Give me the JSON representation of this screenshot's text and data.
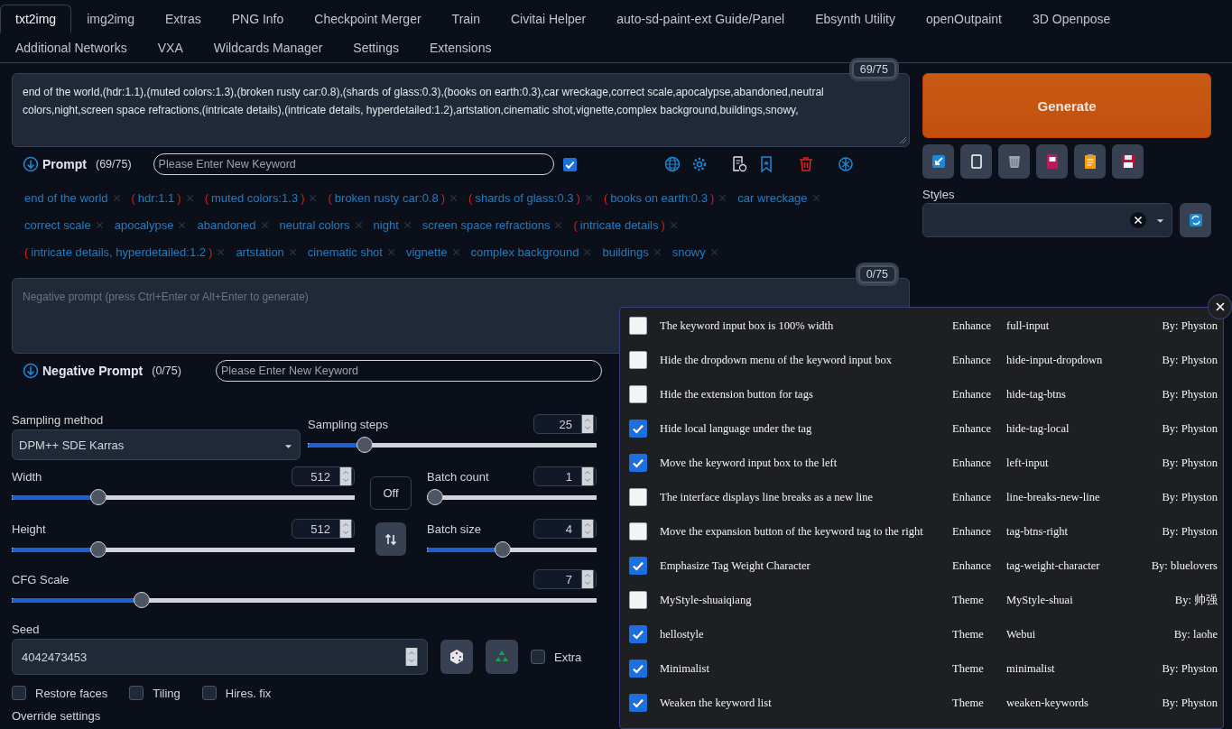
{
  "tab_rows": [
    [
      {
        "label": "txt2img",
        "selected": true
      },
      {
        "label": "img2img",
        "selected": false
      },
      {
        "label": "Extras",
        "selected": false
      },
      {
        "label": "PNG Info",
        "selected": false
      },
      {
        "label": "Checkpoint Merger",
        "selected": false
      },
      {
        "label": "Train",
        "selected": false
      },
      {
        "label": "Civitai Helper",
        "selected": false
      },
      {
        "label": "auto-sd-paint-ext Guide/Panel",
        "selected": false
      },
      {
        "label": "Ebsynth Utility",
        "selected": false
      },
      {
        "label": "openOutpaint",
        "selected": false
      },
      {
        "label": "3D Openpose",
        "selected": false
      }
    ],
    [
      {
        "label": "Additional Networks",
        "selected": false
      },
      {
        "label": "VXA",
        "selected": false
      },
      {
        "label": "Wildcards Manager",
        "selected": false
      },
      {
        "label": "Settings",
        "selected": false
      },
      {
        "label": "Extensions",
        "selected": false
      }
    ]
  ],
  "prompt": {
    "text": "end of the world,(hdr:1.1),(muted colors:1.3),(broken rusty car:0.8),(shards of glass:0.3),(books on earth:0.3),car wreckage,correct scale,apocalypse,abandoned,neutral colors,night,screen space refractions,(intricate details),(intricate details, hyperdetailed:1.2),artstation,cinematic shot,vignette,complex background,buildings,snowy,",
    "counter": "69/75",
    "label": "Prompt",
    "count": "(69/75)",
    "keyword_placeholder": "Please Enter New Keyword",
    "keyword_toggle_checked": true,
    "tags": [
      {
        "text": "end of the world"
      },
      {
        "text": "hdr:1.1",
        "open": "(",
        "close": ")"
      },
      {
        "text": "muted colors:1.3",
        "open": "(",
        "close": ")"
      },
      {
        "text": "broken rusty car:0.8",
        "open": "(",
        "close": ")"
      },
      {
        "text": "shards of glass:0.3",
        "open": "(",
        "close": ")"
      },
      {
        "text": "books on earth:0.3",
        "open": "(",
        "close": ")"
      },
      {
        "text": "car wreckage"
      },
      {
        "text": "correct scale"
      },
      {
        "text": "apocalypse"
      },
      {
        "text": "abandoned"
      },
      {
        "text": "neutral colors"
      },
      {
        "text": "night"
      },
      {
        "text": "screen space refractions"
      },
      {
        "text": "intricate details",
        "open": "(",
        "close": ")"
      },
      {
        "text": "intricate details, hyperdetailed:1.2",
        "open": "(",
        "close": ")"
      },
      {
        "text": "artstation"
      },
      {
        "text": "cinematic shot"
      },
      {
        "text": "vignette"
      },
      {
        "text": "complex background"
      },
      {
        "text": "buildings"
      },
      {
        "text": "snowy"
      }
    ]
  },
  "negative": {
    "placeholder": "Negative prompt (press Ctrl+Enter or Alt+Enter to generate)",
    "counter": "0/75",
    "label": "Negative Prompt",
    "count": "(0/75)",
    "keyword_placeholder": "Please Enter New Keyword"
  },
  "generate": {
    "label": "Generate"
  },
  "styles": {
    "label": "Styles"
  },
  "settings": {
    "sampling_method": {
      "label": "Sampling method",
      "value": "DPM++ SDE Karras"
    },
    "sampling_steps": {
      "label": "Sampling steps",
      "value": "25",
      "level": 0.18
    },
    "width": {
      "label": "Width",
      "value": "512",
      "level": 0.24
    },
    "height": {
      "label": "Height",
      "value": "512",
      "level": 0.24
    },
    "batch_count": {
      "label": "Batch count",
      "value": "1",
      "level": 0
    },
    "batch_size": {
      "label": "Batch size",
      "value": "4",
      "level": 0.44
    },
    "cfg_scale": {
      "label": "CFG Scale",
      "value": "7",
      "level": 0.215
    },
    "toggle": {
      "label": "Off"
    },
    "seed": {
      "label": "Seed",
      "value": "4042473453"
    },
    "extra": {
      "label": "Extra",
      "checked": false
    },
    "options": [
      {
        "label": "Restore faces",
        "checked": false
      },
      {
        "label": "Tiling",
        "checked": false
      },
      {
        "label": "Hires. fix",
        "checked": false
      }
    ],
    "override_label": "Override settings"
  },
  "extensions_popup": {
    "rows": [
      {
        "checked": false,
        "description": "The keyword input box is 100% width",
        "type": "Enhance",
        "key": "full-input",
        "author": "By: Physton"
      },
      {
        "checked": false,
        "description": "Hide the dropdown menu of the keyword input box",
        "type": "Enhance",
        "key": "hide-input-dropdown",
        "author": "By: Physton"
      },
      {
        "checked": false,
        "description": "Hide the extension button for tags",
        "type": "Enhance",
        "key": "hide-tag-btns",
        "author": "By: Physton"
      },
      {
        "checked": true,
        "description": "Hide local language under the tag",
        "type": "Enhance",
        "key": "hide-tag-local",
        "author": "By: Physton"
      },
      {
        "checked": true,
        "description": "Move the keyword input box to the left",
        "type": "Enhance",
        "key": "left-input",
        "author": "By: Physton"
      },
      {
        "checked": false,
        "description": "The interface displays line breaks as a new line",
        "type": "Enhance",
        "key": "line-breaks-new-line",
        "author": "By: Physton"
      },
      {
        "checked": false,
        "description": "Move the expansion button of the keyword tag to the right",
        "type": "Enhance",
        "key": "tag-btns-right",
        "author": "By: Physton"
      },
      {
        "checked": true,
        "description": "Emphasize Tag Weight Character",
        "type": "Enhance",
        "key": "tag-weight-character",
        "author": "By: bluelovers"
      },
      {
        "checked": false,
        "description": "MyStyle-shuaiqiang",
        "type": "Theme",
        "key": "MyStyle-shuai",
        "author": "By: 帅强"
      },
      {
        "checked": true,
        "description": "hellostyle",
        "type": "Theme",
        "key": "Webui",
        "author": "By: laohe"
      },
      {
        "checked": true,
        "description": "Minimalist",
        "type": "Theme",
        "key": "minimalist",
        "author": "By: Physton"
      },
      {
        "checked": true,
        "description": "Weaken the keyword list",
        "type": "Theme",
        "key": "weaken-keywords",
        "author": "By: Physton"
      }
    ]
  }
}
